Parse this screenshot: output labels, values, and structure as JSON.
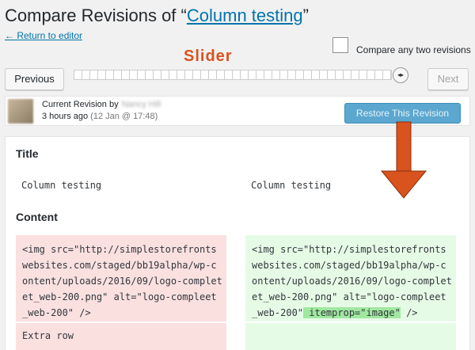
{
  "header": {
    "title_prefix": "Compare Revisions of “",
    "title_link": "Column testing",
    "title_suffix": "”",
    "return_link": "← Return to editor",
    "compare_any_label": "Compare any two revisions"
  },
  "annotation": {
    "slider_label": "Slider"
  },
  "nav": {
    "previous_label": "Previous",
    "next_label": "Next",
    "slider_handle_icon": "◂▸"
  },
  "revision": {
    "current_label": "Current Revision by",
    "author_name": "Nancy Hill",
    "relative_time": "3 hours ago",
    "date": "(12 Jan @ 17:48)",
    "restore_label": "Restore This Revision"
  },
  "diff": {
    "title_heading": "Title",
    "title_left": "Column testing",
    "title_right": "Column testing",
    "content_heading": "Content",
    "removed_lines": "<img src=\"http://simplestorefronts\nwebsites.com/staged/bb19alpha/wp-c\nontent/uploads/2016/09/logo-complet\net_web-200.png\" alt=\"logo-compleet\n_web-200\" />",
    "added_lines_base": "<img src=\"http://simplestorefronts\nwebsites.com/staged/bb19alpha/wp-c\nontent/uploads/2016/09/logo-complet\net_web-200.png\" alt=\"logo-compleet\n_web-200\"",
    "added_highlight": " itemprop=\"image\"",
    "added_tail": " />",
    "extra_row": "Extra row"
  },
  "colors": {
    "link": "#0073aa",
    "annotation": "#d9531e",
    "arrow_fill": "#d9531e",
    "restore_button": "#5ba7cf",
    "removed_bg": "#fbe0e0",
    "added_bg": "#e6fbe6",
    "added_highlight": "#a0e8a0"
  }
}
